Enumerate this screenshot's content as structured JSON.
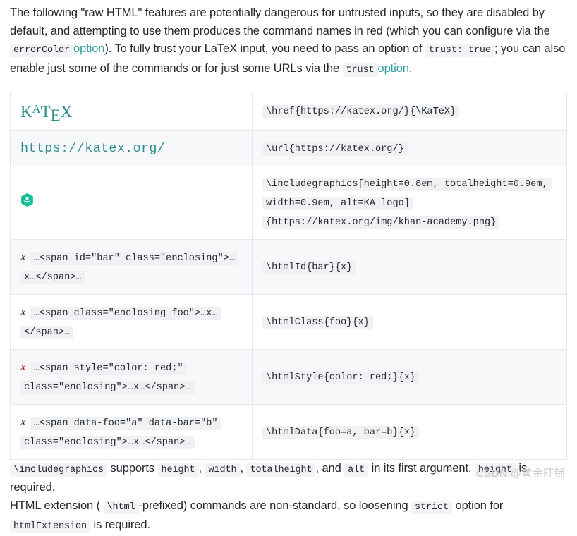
{
  "intro": {
    "seg1": "The following \"raw HTML\" features are potentially dangerous for untrusted inputs, so they are disabled by default, and attempting to use them produces the command names in red (which you can configure via the",
    "code_errorcolor": "errorColor",
    "link_option1": "option",
    "seg2": "). To fully trust your LaTeX input, you need to pass an option of",
    "code_trust_true": "trust: true",
    "seg3": "; you can also enable just some of the commands or for just some URLs via the",
    "code_trust": "trust",
    "link_option2": "option",
    "seg4": "."
  },
  "table": {
    "rows": [
      {
        "id": "href",
        "left_kind": "katex-logo",
        "left_logo": "KATEX",
        "left_logo_k": "K",
        "left_logo_a": "A",
        "left_logo_t": "T",
        "left_logo_e": "E",
        "left_logo_x": "X",
        "right_code": "\\href{https://katex.org/}{\\KaTeX}"
      },
      {
        "id": "url",
        "left_kind": "url",
        "left_url": "https://katex.org/",
        "right_code": "\\url{https://katex.org/}"
      },
      {
        "id": "includegraphics",
        "left_kind": "ka-icon",
        "left_icon": "khan-academy-icon",
        "right_code": "\\includegraphics[height=0.8em, totalheight=0.9em, width=0.9em, alt=KA logo]{https://katex.org/img/khan-academy.png}"
      },
      {
        "id": "htmlId",
        "left_kind": "math-html",
        "left_math": "x",
        "left_math_red": false,
        "left_code": "…<span id=\"bar\" class=\"enclosing\">…x…</span>…",
        "right_code": "\\htmlId{bar}{x}"
      },
      {
        "id": "htmlClass",
        "left_kind": "math-html",
        "left_math": "x",
        "left_math_red": false,
        "left_code": "…<span class=\"enclosing foo\">…x…</span>…",
        "right_code": "\\htmlClass{foo}{x}"
      },
      {
        "id": "htmlStyle",
        "left_kind": "math-html",
        "left_math": "x",
        "left_math_red": true,
        "left_code": "…<span style=\"color: red;\" class=\"enclosing\">…x…</span>…",
        "right_code": "\\htmlStyle{color: red;}{x}"
      },
      {
        "id": "htmlData",
        "left_kind": "math-html",
        "left_math": "x",
        "left_math_red": false,
        "left_code": "…<span data-foo=\"a\" data-bar=\"b\" class=\"enclosing\">…x…</span>…",
        "right_code": "\\htmlData{foo=a, bar=b}{x}"
      }
    ]
  },
  "footer": {
    "p1": {
      "code_includegraphics": "\\includegraphics",
      "t1": "supports",
      "code_height": "height",
      "c1": ",",
      "code_width": "width",
      "c2": ",",
      "code_totalheight": "totalheight",
      "t2": ", and",
      "code_alt": "alt",
      "t3": "in its first argument.",
      "code_height2": "height",
      "t4": "is required."
    },
    "p2": {
      "t1": "HTML extension (",
      "code_html": "\\html",
      "t2": "-prefixed) commands are non-standard, so loosening",
      "code_strict": "strict",
      "t3": "option for",
      "code_htmlextension": "htmlExtension",
      "t4": "is required."
    }
  },
  "watermark": "CSDN @黄金旺铺",
  "colors": {
    "link": "#2f9e9e",
    "katex_teal": "#2f8e8e",
    "error_red": "#cc0000",
    "khan_green": "#14bf96",
    "code_bg": "#eff1f3",
    "row_stripe": "#f6f8fa",
    "border": "#e6e9ec"
  }
}
